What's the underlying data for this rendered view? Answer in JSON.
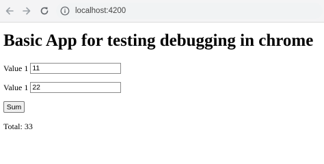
{
  "browser": {
    "url": "localhost:4200",
    "icons": {
      "back": "arrow-left-icon",
      "forward": "arrow-right-icon",
      "reload": "reload-icon",
      "info": "info-icon"
    }
  },
  "page": {
    "heading": "Basic App for testing debugging in chrome",
    "fields": [
      {
        "label": "Value 1",
        "value": "11"
      },
      {
        "label": "Value 1",
        "value": "22"
      }
    ],
    "sum_button_label": "Sum",
    "total": {
      "label": "Total:",
      "value": "33"
    }
  }
}
